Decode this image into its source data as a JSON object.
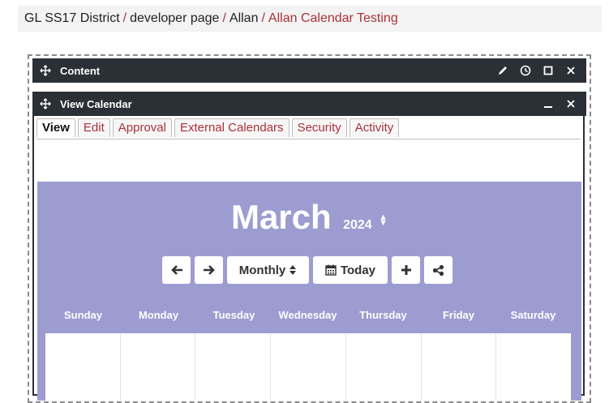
{
  "breadcrumb": {
    "items": [
      "GL SS17 District",
      "developer page",
      "Allan"
    ],
    "current": "Allan Calendar Testing",
    "separator": "/"
  },
  "content_panel": {
    "title": "Content"
  },
  "view_panel": {
    "title": "View Calendar"
  },
  "tabs": [
    {
      "label": "View",
      "active": true
    },
    {
      "label": "Edit"
    },
    {
      "label": "Approval"
    },
    {
      "label": "External Calendars"
    },
    {
      "label": "Security"
    },
    {
      "label": "Activity"
    }
  ],
  "calendar": {
    "month": "March",
    "year": "2024",
    "view_label": "Monthly",
    "today_label": "Today",
    "days": [
      "Sunday",
      "Monday",
      "Tuesday",
      "Wednesday",
      "Thursday",
      "Friday",
      "Saturday"
    ],
    "background_color": "#9d9cd1"
  },
  "colors": {
    "link": "#a8323a",
    "panel_header": "#2b2f36"
  }
}
